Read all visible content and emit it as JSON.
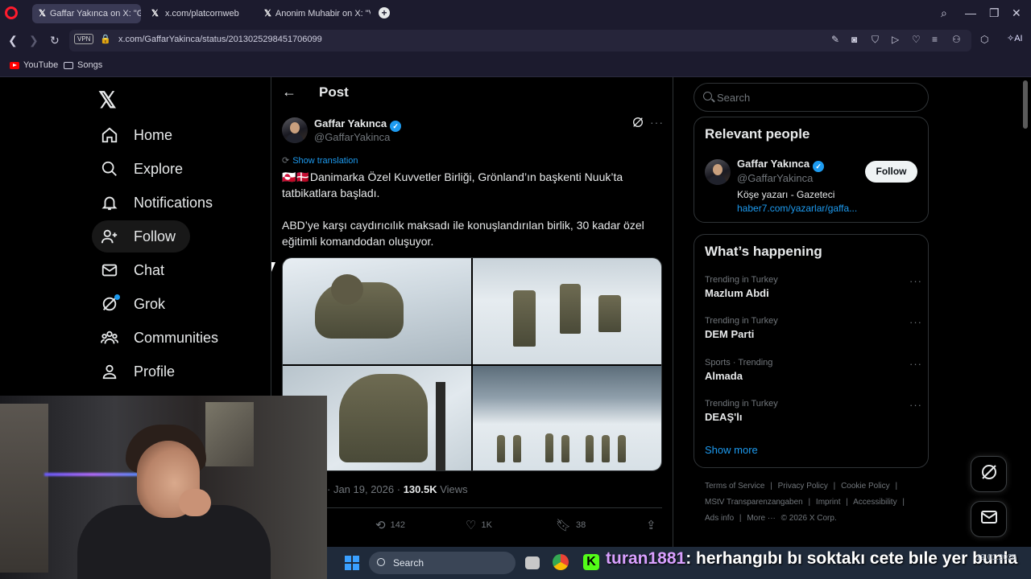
{
  "browser": {
    "tabs": [
      {
        "label": "Gaffar Yakınca on X: \"GLDK",
        "active": true
      },
      {
        "label": "x.com/platcornweb",
        "active": false
      },
      {
        "label": "Anonim Muhabir on X: \"Vi",
        "active": false
      }
    ],
    "vpn_label": "VPN",
    "url": "x.com/GaffarYakinca/status/2013025298451706099",
    "ai_label": "AI",
    "bookmarks": [
      {
        "label": "YouTube",
        "icon": "youtube-icon"
      },
      {
        "label": "Songs",
        "icon": "folder-icon"
      }
    ]
  },
  "sidebar": {
    "items": [
      {
        "label": "Home",
        "icon": "home-icon"
      },
      {
        "label": "Explore",
        "icon": "search-icon"
      },
      {
        "label": "Notifications",
        "icon": "bell-icon"
      },
      {
        "label": "Follow",
        "icon": "follow-icon"
      },
      {
        "label": "Chat",
        "icon": "mail-icon"
      },
      {
        "label": "Grok",
        "icon": "grok-icon"
      },
      {
        "label": "Communities",
        "icon": "communities-icon"
      },
      {
        "label": "Profile",
        "icon": "profile-icon"
      }
    ]
  },
  "post": {
    "header_title": "Post",
    "author_name": "Gaffar Yakınca",
    "author_handle": "@GaffarYakinca",
    "show_translation": "Show translation",
    "text_1": "🇬🇱🇩🇰Danimarka Özel Kuvvetler Birliği, Grönland’ın başkenti Nuuk’ta tatbikatlara başladı.",
    "text_2": "ABD’ye karşı caydırıcılık maksadı ile konuşlandırılan birlik, 30 kadar özel eğitimli komandodan oluşuyor.",
    "date": "· Jan 19, 2026 ·",
    "views_count": "130.5K",
    "views_label": "Views",
    "retweets": "142",
    "likes": "1K",
    "bookmarks": "38"
  },
  "right": {
    "search_placeholder": "Search",
    "relevant_title": "Relevant people",
    "relevant": {
      "name": "Gaffar Yakınca",
      "handle": "@GaffarYakinca",
      "bio": "Köşe yazarı - Gazeteci",
      "link": "haber7.com/yazarlar/gaffa...",
      "follow_label": "Follow"
    },
    "happening_title": "What’s happening",
    "trends": [
      {
        "context": "Trending in Turkey",
        "title": "Mazlum Abdi"
      },
      {
        "context": "Trending in Turkey",
        "title": "DEM Parti"
      },
      {
        "context": "Sports · Trending",
        "title": "Almada"
      },
      {
        "context": "Trending in Turkey",
        "title": "DEAŞ'lı"
      }
    ],
    "show_more": "Show more",
    "footer_line1": [
      "Terms of Service",
      "|",
      "Privacy Policy",
      "|",
      "Cookie Policy",
      "|"
    ],
    "footer_line2": [
      "MStV Transparenzangaben",
      "|",
      "Imprint",
      "|",
      "Accessibility",
      "|"
    ],
    "footer_line3": [
      "Ads info",
      "|",
      "More ···",
      "© 2026 X Corp."
    ]
  },
  "taskbar": {
    "search_label": "Search",
    "chat_user": "turan1881",
    "chat_message": ": herhangıbı bı soktakı cete bıle yer bunla",
    "time_date": "19.01.2026"
  },
  "colors": {
    "accent": "#1d9bf0",
    "background": "#000000",
    "muted": "#71767b"
  }
}
